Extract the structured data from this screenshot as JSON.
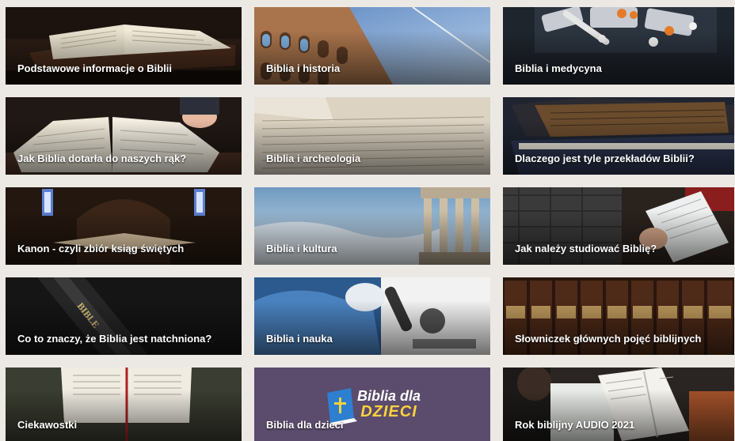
{
  "tiles": [
    {
      "label": "Podstawowe informacje o Biblii",
      "icon": "open-book-image",
      "color": "#3a2a20"
    },
    {
      "label": "Biblia i historia",
      "icon": "colosseum-image",
      "color": "#6a90c0"
    },
    {
      "label": "Biblia i medycyna",
      "icon": "pills-image",
      "color": "#232a33"
    },
    {
      "label": "Jak Biblia dotarła do naszych rąk?",
      "icon": "reading-hands-image",
      "color": "#2c2420"
    },
    {
      "label": "Biblia i archeologia",
      "icon": "manuscript-image",
      "color": "#d8cfbf"
    },
    {
      "label": "Dlaczego jest tyle przekładów Biblii?",
      "icon": "stacked-books-image",
      "color": "#2b2a2a"
    },
    {
      "label": "Kanon - czyli zbiór ksiąg świętych",
      "icon": "church-interior-image",
      "color": "#2a1c16"
    },
    {
      "label": "Biblia i kultura",
      "icon": "greek-temple-image",
      "color": "#8fb0c8"
    },
    {
      "label": "Jak należy studiować Biblię?",
      "icon": "study-bible-image",
      "color": "#3b2a22"
    },
    {
      "label": "Co to znaczy, że Biblia jest natchniona?",
      "icon": "bible-spine-image",
      "color": "#1b1b1b"
    },
    {
      "label": "Biblia i nauka",
      "icon": "microscope-image",
      "color": "#3e6ea2"
    },
    {
      "label": "Słowniczek głównych pojęć biblijnych",
      "icon": "book-spines-image",
      "color": "#3a2418"
    },
    {
      "label": "Ciekawostki",
      "icon": "bible-on-grass-image",
      "color": "#30332a"
    },
    {
      "label": "Biblia dla dzieci",
      "icon": "kids-bible-logo",
      "color": "#5b4b6c"
    },
    {
      "label": "Rok biblijny AUDIO 2021",
      "icon": "person-reading-image",
      "color": "#2c2a28"
    }
  ],
  "kids_logo": {
    "line1": "Biblia dla",
    "line2": "DZIECI"
  }
}
